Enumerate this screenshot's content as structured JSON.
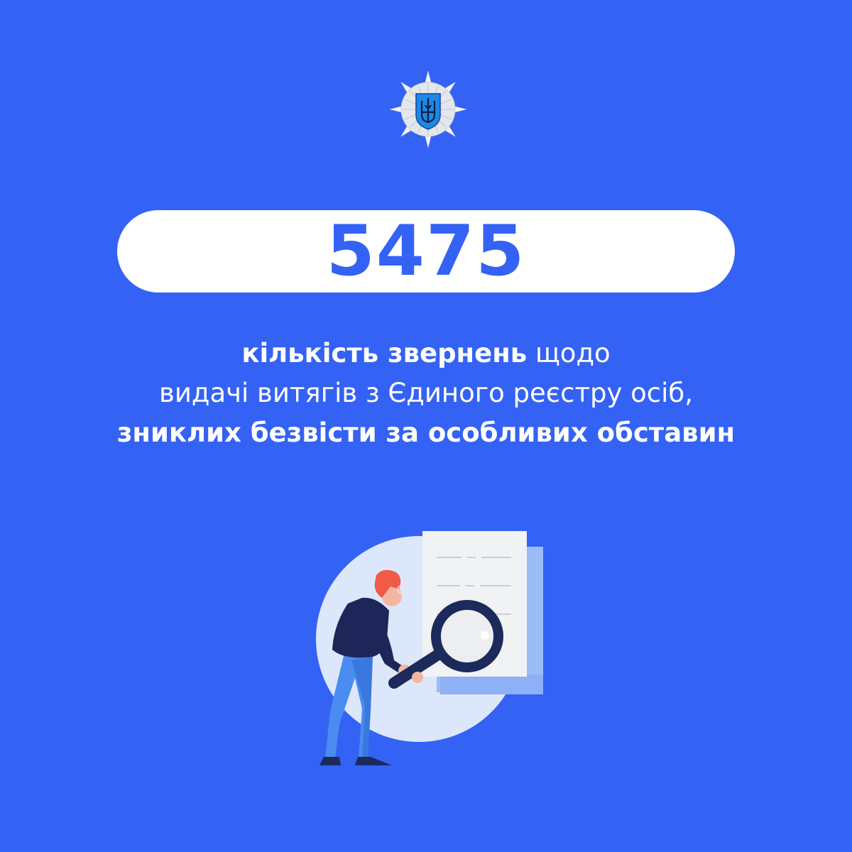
{
  "headline": {
    "number": "5475"
  },
  "caption": {
    "line1_bold": "кількість звернень",
    "line1_regular": "щодо",
    "line2": "видачі витягів з Єдиного реєстру осіб,",
    "line3_bold": "зниклих безвісти за особливих обставин"
  },
  "colors": {
    "background": "#3462F5",
    "pill": "#FFFFFF",
    "number": "#3462F5",
    "text": "#FFFFFF"
  },
  "icons": {
    "emblem": "national-police-emblem",
    "illustration": "person-with-magnifier-document"
  }
}
